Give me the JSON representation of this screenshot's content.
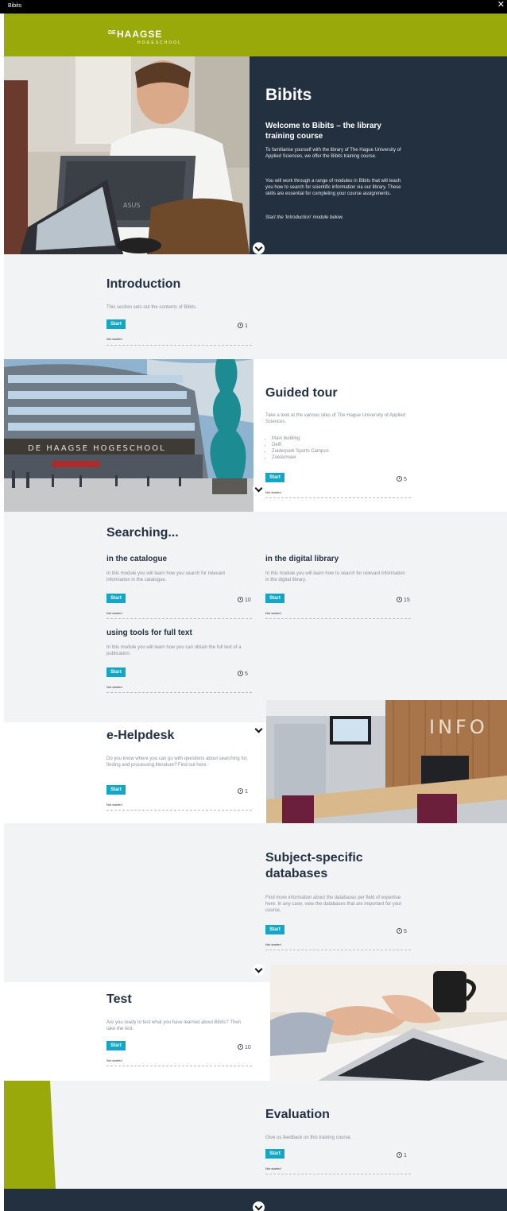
{
  "window": {
    "title": "Bibits",
    "close_glyph": "✕"
  },
  "header": {
    "logo_de": "DE",
    "logo_haagse": "HAAGSE",
    "logo_hogeschool": "HOGESCHOOL"
  },
  "hero": {
    "title": "Bibits",
    "subtitle": "Welcome to Bibits – the library training course",
    "para1": "To familiarise yourself with the library of The Hague University of Applied Sciences, we offer the Bibits training course.",
    "para2": "You will work through a range of modules in Bibits that will teach you how to search for scientific information via our library. These skills are essential for completing your course assignments.",
    "para3": "Start the 'Introduction' module below."
  },
  "intro": {
    "title": "Introduction",
    "desc": "This section sets out the contents of Bibits.",
    "start": "Start",
    "time": "1",
    "status": "Not started"
  },
  "tour": {
    "title": "Guided tour",
    "desc": "Take a look at the various sites of The Hague University of Applied Sciences.",
    "items": [
      "Main building",
      "Delft",
      "Zuiderpark Sports Campus",
      "Zoetermeer"
    ],
    "start": "Start",
    "time": "5",
    "status": "Not started"
  },
  "searching": {
    "title": "Searching...",
    "catalogue": {
      "title": "in the catalogue",
      "desc": "In this module you will learn how you search for relevant information in the catalogue.",
      "start": "Start",
      "time": "10",
      "status": "Not started"
    },
    "digital": {
      "title": "in the digital library",
      "desc": "In this module you will learn how to search for relevant information in the digital library.",
      "start": "Start",
      "time": "15",
      "status": "Not started"
    },
    "fulltext": {
      "title": "using tools for full text",
      "desc": "In this module you will learn how you can obtain the full text of a publication.",
      "start": "Start",
      "time": "5",
      "status": "Not started"
    }
  },
  "helpdesk": {
    "title": "e-Helpdesk",
    "desc": "Do you know where you can go with questions about searching for, finding and processing literature? Find out here.",
    "start": "Start",
    "time": "1",
    "status": "Not started",
    "photo_sign": "INFO"
  },
  "subject": {
    "title": "Subject-specific databases",
    "desc": "Find more information about the databases per field of expertise here. In any case, view the databases that are important for your course.",
    "start": "Start",
    "time": "5",
    "status": "Not started"
  },
  "test": {
    "title": "Test",
    "desc": "Are you ready to test what you have learned about Bibits? Then take the test.",
    "start": "Start",
    "time": "10",
    "status": "Not started"
  },
  "evaluation": {
    "title": "Evaluation",
    "desc": "Give us feedback on this training course.",
    "start": "Start",
    "time": "1",
    "status": "Not started"
  },
  "colors": {
    "green": "#9aa90a",
    "navy": "#22303f",
    "button": "#14a6c5",
    "grey": "#f2f3f5"
  },
  "photo_labels": {
    "building_sign": "DE HAAGSE HOGESCHOOL",
    "laptop_brand": "ASUS"
  }
}
